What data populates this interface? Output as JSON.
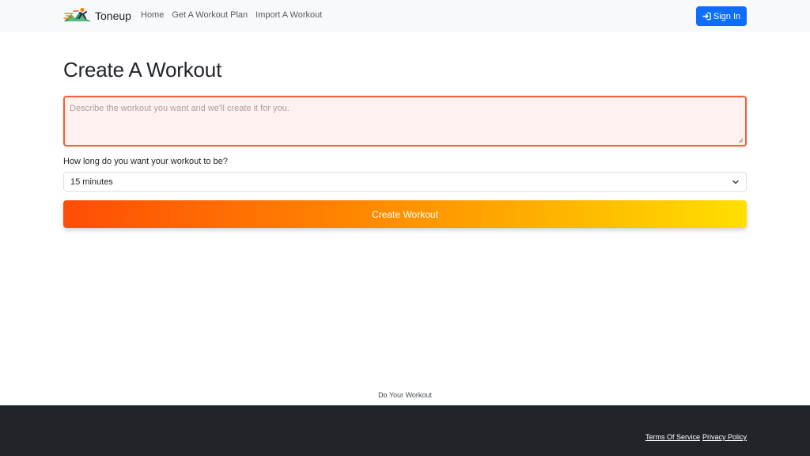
{
  "navbar": {
    "brand": "Toneup",
    "links": [
      "Home",
      "Get A Workout Plan",
      "Import A Workout"
    ],
    "signin_label": "Sign In",
    "signin_color": "#0d6efd"
  },
  "main": {
    "title": "Create A Workout",
    "describe_placeholder": "Describe the workout you want and we'll create it for you.",
    "duration_label": "How long do you want your workout to be?",
    "duration_selected": "15 minutes",
    "create_label": "Create Workout",
    "accent_colors": [
      "#ff4d06",
      "#ffdf00"
    ]
  },
  "footer": {
    "tagline": "Do Your Workout",
    "links": [
      "Terms Of Service",
      "Privacy Policy"
    ],
    "background": "#212529"
  },
  "icons": {
    "brand": "runner-logo-icon",
    "signin": "sign-in-arrow-icon",
    "select": "chevron-down-icon"
  }
}
